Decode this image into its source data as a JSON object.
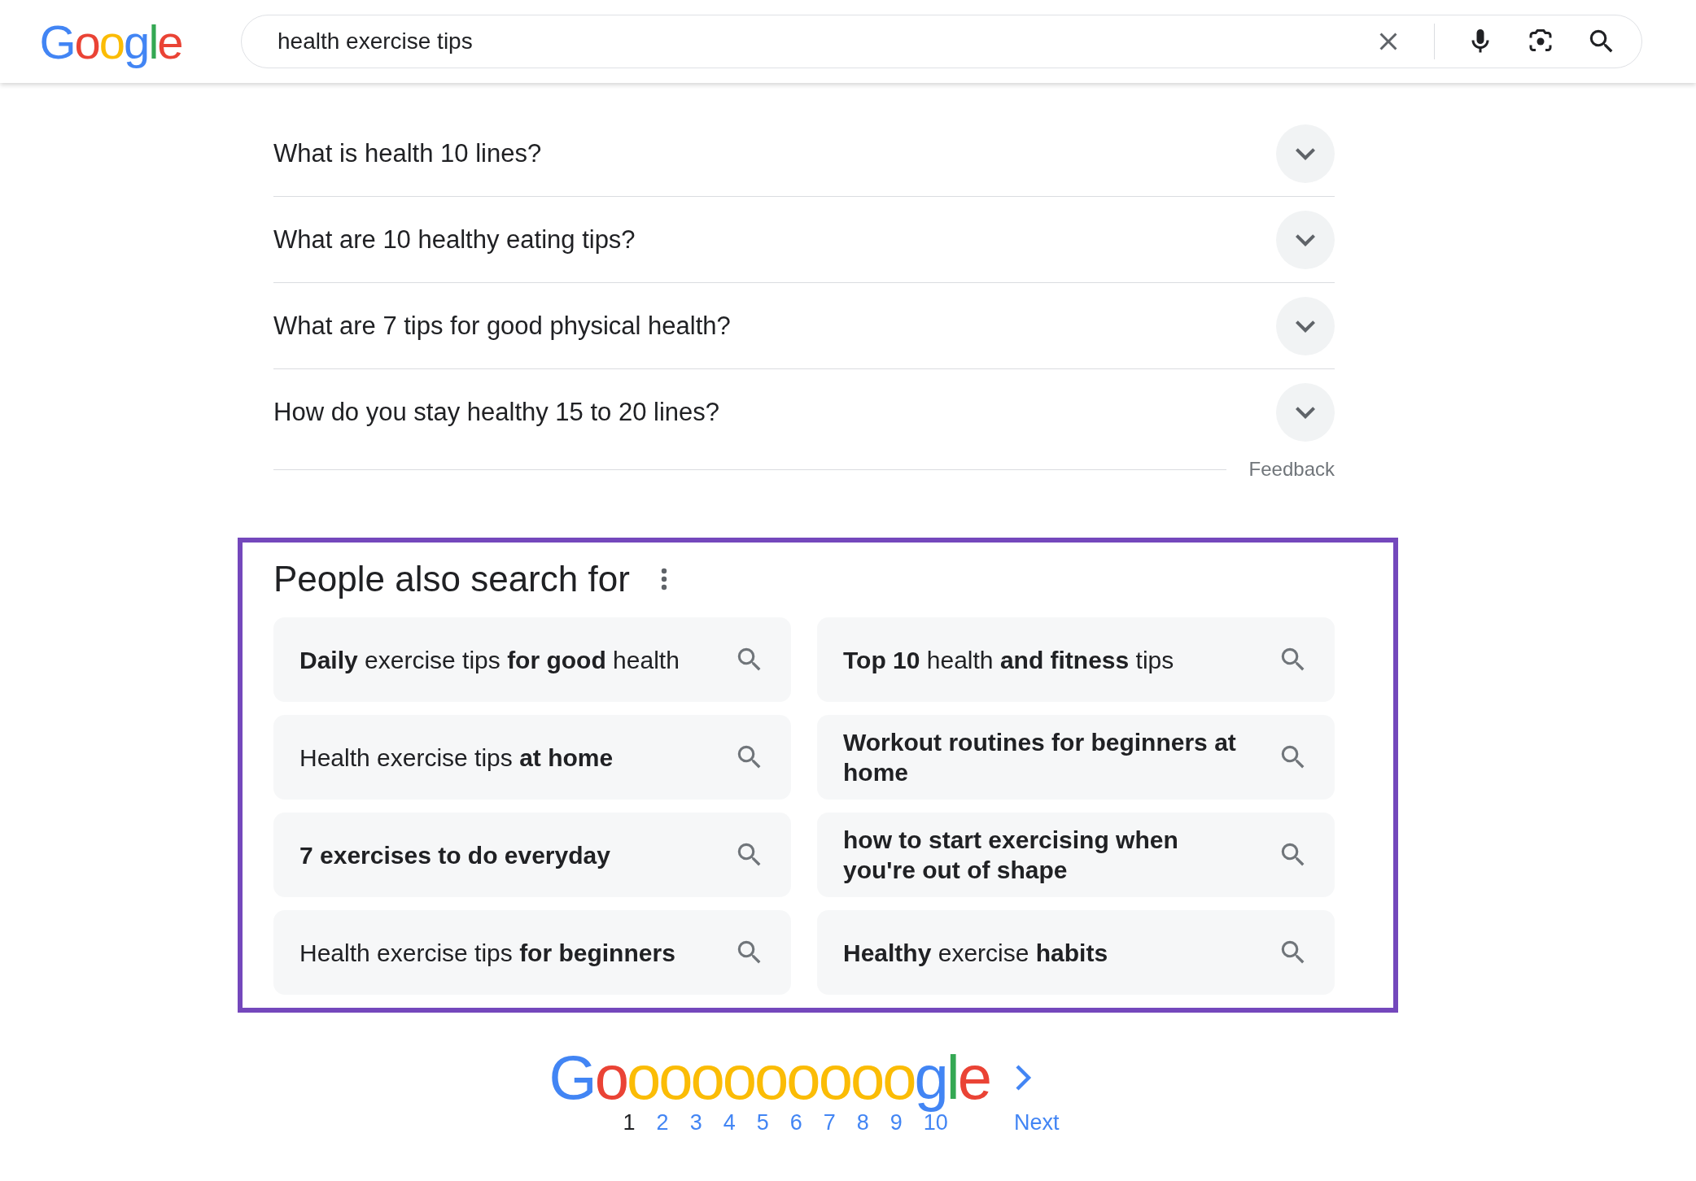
{
  "header": {
    "logo": [
      {
        "text": "G",
        "color": "#4285f4"
      },
      {
        "text": "o",
        "color": "#ea4335"
      },
      {
        "text": "o",
        "color": "#fbbc05"
      },
      {
        "text": "g",
        "color": "#4285f4"
      },
      {
        "text": "l",
        "color": "#34a853"
      },
      {
        "text": "e",
        "color": "#ea4335"
      }
    ],
    "search": {
      "value": "health exercise tips"
    }
  },
  "people_also_ask": {
    "questions": [
      {
        "text": "What is health 10 lines?",
        "expanded": false
      },
      {
        "text": "What are 10 healthy eating tips?",
        "expanded": false
      },
      {
        "text": "What are 7 tips for good physical health?",
        "expanded": false
      },
      {
        "text": "How do you stay healthy 15 to 20 lines?",
        "expanded": false
      }
    ],
    "feedback": "Feedback"
  },
  "people_also_search_for": {
    "title": "People also search for",
    "suggestions": [
      "**Daily** exercise tips **for good** health",
      "Health exercise tips **at home**",
      "**7 exercises to do everyday**",
      "Health exercise tips **for beginners**",
      "**Top 10** health **and fitness** tips",
      "**Workout routines for beginners at home**",
      "**how to start exercising when you're out of shape**",
      "**Healthy** exercise **habits**"
    ]
  },
  "pagination": {
    "logo": [
      {
        "text": "G",
        "color": "#4285f4"
      },
      {
        "text": "o",
        "color": "#ea4335"
      },
      {
        "text": "o",
        "color": "#fbbc05"
      },
      {
        "text": "o",
        "color": "#fbbc05"
      },
      {
        "text": "o",
        "color": "#fbbc05"
      },
      {
        "text": "o",
        "color": "#fbbc05"
      },
      {
        "text": "o",
        "color": "#fbbc05"
      },
      {
        "text": "o",
        "color": "#fbbc05"
      },
      {
        "text": "o",
        "color": "#fbbc05"
      },
      {
        "text": "o",
        "color": "#fbbc05"
      },
      {
        "text": "o",
        "color": "#fbbc05"
      },
      {
        "text": "g",
        "color": "#4285f4"
      },
      {
        "text": "l",
        "color": "#34a853"
      },
      {
        "text": "e",
        "color": "#ea4335"
      }
    ],
    "pages": [
      {
        "label": "1",
        "selected": true
      },
      {
        "label": "2",
        "selected": false
      },
      {
        "label": "3",
        "selected": false
      },
      {
        "label": "4",
        "selected": false
      },
      {
        "label": "5",
        "selected": false
      },
      {
        "label": "6",
        "selected": false
      },
      {
        "label": "7",
        "selected": false
      },
      {
        "label": "8",
        "selected": false
      },
      {
        "label": "9",
        "selected": false
      },
      {
        "label": "10",
        "selected": false
      }
    ],
    "next": "Next"
  }
}
